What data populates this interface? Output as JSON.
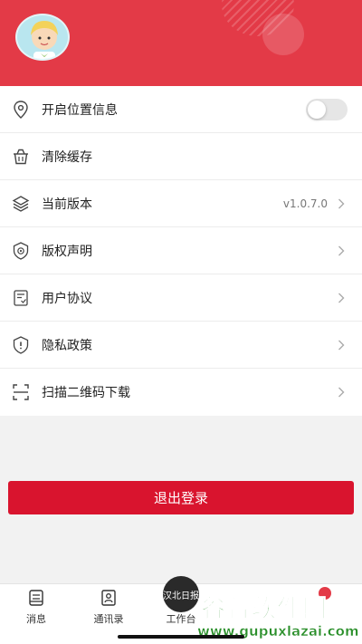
{
  "menu": {
    "location_label": "开启位置信息",
    "clear_cache_label": "清除缓存",
    "version_label": "当前版本",
    "version_value": "v1.0.7.0",
    "copyright_label": "版权声明",
    "user_agreement_label": "用户协议",
    "privacy_label": "隐私政策",
    "scan_download_label": "扫描二维码下载"
  },
  "logout_label": "退出登录",
  "tabbar": {
    "messages": "消息",
    "contacts": "通讯录",
    "workbench": "工作台"
  },
  "center_logo_text": "汉北日报",
  "watermark": {
    "title": "谷普软件园",
    "url": "www.gupuxlazai.com"
  },
  "colors": {
    "header_red": "#e33a47",
    "logout_red": "#d9142e",
    "watermark_green": "#2a8f2a"
  }
}
